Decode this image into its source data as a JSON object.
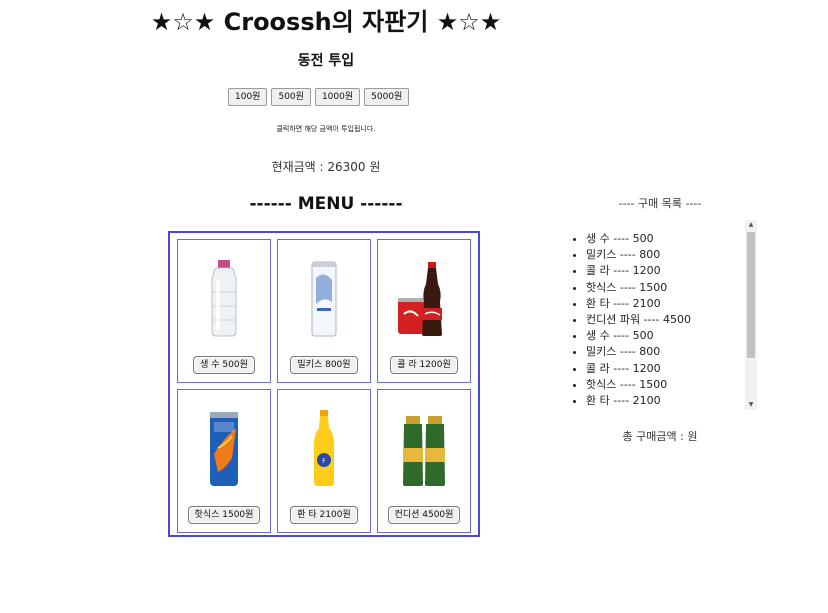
{
  "title": "★☆★ Croossh의 자판기 ★☆★",
  "coin_section": {
    "heading": "동전 투입",
    "buttons": [
      "100원",
      "500원",
      "1000원",
      "5000원"
    ],
    "hint": "클릭하면 해당 금액이 투입됩니다.",
    "amount_text": "현재금액 : 26300 원"
  },
  "menu": {
    "heading": "------ MENU ------",
    "items": [
      {
        "label": "생 수  500원",
        "icon": "water-bottle-icon"
      },
      {
        "label": "밀키스 800원",
        "icon": "milkis-can-icon"
      },
      {
        "label": "콜 라 1200원",
        "icon": "cola-bottle-icon"
      },
      {
        "label": "핫식스 1500원",
        "icon": "hot6-can-icon"
      },
      {
        "label": "환 타 2100원",
        "icon": "fanta-bottle-icon"
      },
      {
        "label": "컨디션 4500원",
        "icon": "condition-drink-icon"
      }
    ]
  },
  "purchase": {
    "heading": "---- 구매 목록 ----",
    "items": [
      "생 수 ---- 500",
      "밀키스 ---- 800",
      "콜 라 ---- 1200",
      "핫식스 ---- 1500",
      "환 타 ---- 2100",
      "컨디션 파워 ---- 4500",
      "생 수 ---- 500",
      "밀키스 ---- 800",
      "콜 라 ---- 1200",
      "핫식스 ---- 1500",
      "환 타 ---- 2100"
    ],
    "total_text": "총 구매금액 : 원"
  },
  "colors": {
    "menu_border": "#4a4ad8",
    "cell_border": "#6a6ad8"
  }
}
